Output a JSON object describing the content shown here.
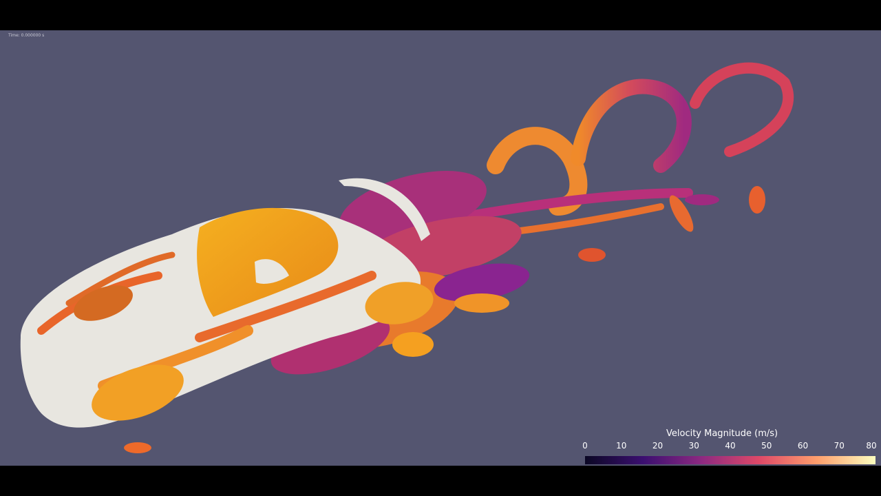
{
  "viewport": {
    "time_label": "Time: 0.000000 s",
    "background_color": "#545570"
  },
  "colorbar": {
    "title": "Velocity Magnitude (m/s)",
    "ticks": [
      "0",
      "10",
      "20",
      "30",
      "40",
      "50",
      "60",
      "70",
      "80"
    ],
    "colormap": "plasma-like",
    "stops": [
      "#0b0724",
      "#3b0f70",
      "#8c2981",
      "#de4968",
      "#fe9f6d",
      "#fcfdbf"
    ]
  },
  "scene": {
    "subject": "car-body",
    "body_color": "#e8e6e0"
  }
}
